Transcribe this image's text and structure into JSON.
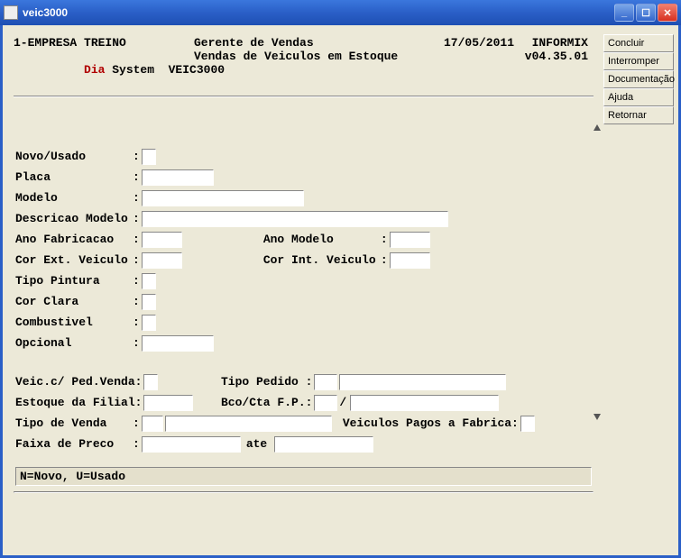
{
  "window": {
    "title": "veic3000"
  },
  "sidebar": {
    "buttons": [
      "Concluir",
      "Interromper",
      "Documentação",
      "Ajuda",
      "Retornar"
    ]
  },
  "header": {
    "company": "1-EMPRESA TREINO",
    "role": "Gerente de Vendas",
    "date": "17/05/2011",
    "db": "INFORMIX",
    "dia": "Dia",
    "system": " System  VEIC3000",
    "subtitle": "Vendas de Veiculos em Estoque",
    "version": "v04.35.01"
  },
  "labels": {
    "novo_usado": "Novo/Usado",
    "placa": "Placa",
    "modelo": "Modelo",
    "descricao_modelo": "Descricao Modelo",
    "ano_fabricacao": "Ano Fabricacao",
    "ano_modelo": "Ano Modelo",
    "cor_ext": "Cor Ext. Veiculo",
    "cor_int": "Cor Int. Veiculo",
    "tipo_pintura": "Tipo Pintura",
    "cor_clara": "Cor Clara",
    "combustivel": "Combustivel",
    "opcional": "Opcional",
    "veic_ped_venda": "Veic.c/ Ped.Venda:",
    "tipo_pedido": "Tipo Pedido :",
    "estoque_filial": "Estoque da Filial:",
    "bco_cta": "Bco/Cta F.P.:",
    "tipo_venda": "Tipo de Venda",
    "veic_pagos": "Veiculos Pagos a Fabrica:",
    "faixa_preco": "Faixa de Preco",
    "ate": "ate"
  },
  "status": "N=Novo, U=Usado",
  "values": {
    "novo_usado": "",
    "placa": "",
    "modelo": "",
    "descricao_modelo": "",
    "ano_fabricacao": "",
    "ano_modelo": "",
    "cor_ext": "",
    "cor_int": "",
    "tipo_pintura": "",
    "cor_clara": "",
    "combustivel": "",
    "opcional": "",
    "veic_ped_venda": "",
    "tipo_pedido_a": "",
    "tipo_pedido_b": "",
    "estoque_filial": "",
    "bco": "",
    "cta": "",
    "tipo_venda_a": "",
    "tipo_venda_b": "",
    "veic_pagos": "",
    "faixa_de": "",
    "faixa_ate": ""
  }
}
